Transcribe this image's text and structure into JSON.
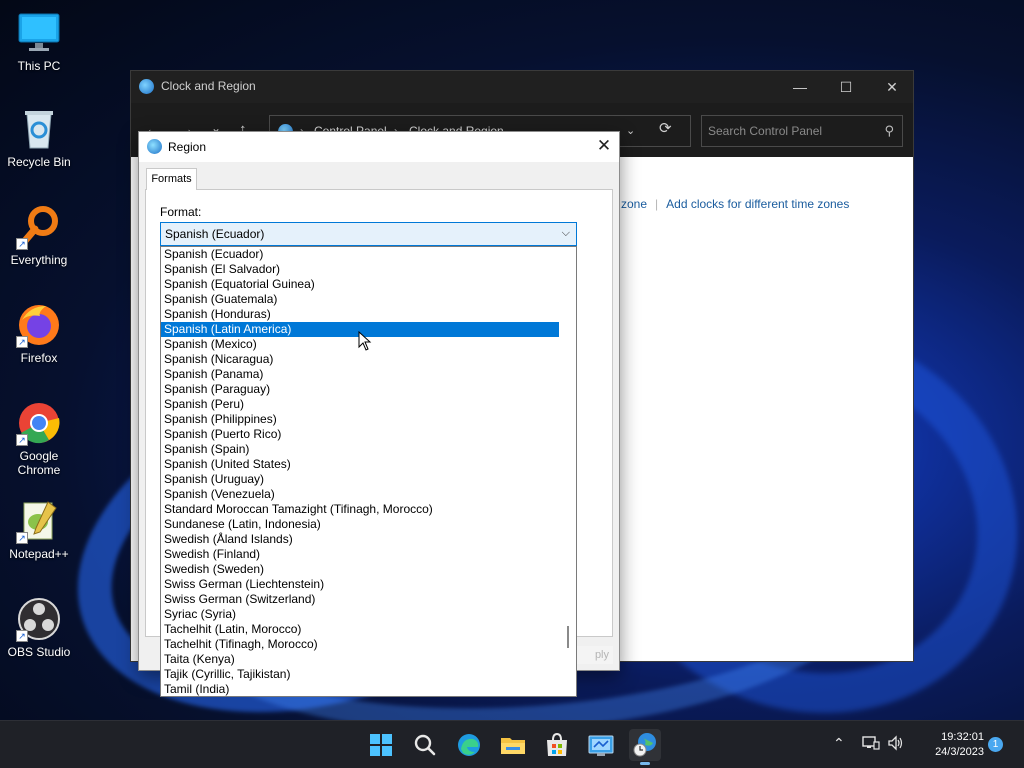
{
  "desktop": {
    "icons": [
      {
        "label": "This PC"
      },
      {
        "label": "Recycle Bin"
      },
      {
        "label": "Everything"
      },
      {
        "label": "Firefox"
      },
      {
        "label": "Google Chrome"
      },
      {
        "label": "Notepad++"
      },
      {
        "label": "OBS Studio"
      }
    ]
  },
  "control_panel": {
    "title": "Clock and Region",
    "breadcrumb": [
      "Control Panel",
      "Clock and Region"
    ],
    "search_placeholder": "Search Control Panel",
    "links": [
      "zone",
      "Add clocks for different time zones"
    ]
  },
  "dialog": {
    "title": "Region",
    "tab": "Formats",
    "format_label": "Format:",
    "format_selected": "Spanish (Ecuador)",
    "apply_partial": "ply",
    "options": [
      "Spanish (Ecuador)",
      "Spanish (El Salvador)",
      "Spanish (Equatorial Guinea)",
      "Spanish (Guatemala)",
      "Spanish (Honduras)",
      "Spanish (Latin America)",
      "Spanish (Mexico)",
      "Spanish (Nicaragua)",
      "Spanish (Panama)",
      "Spanish (Paraguay)",
      "Spanish (Peru)",
      "Spanish (Philippines)",
      "Spanish (Puerto Rico)",
      "Spanish (Spain)",
      "Spanish (United States)",
      "Spanish (Uruguay)",
      "Spanish (Venezuela)",
      "Standard Moroccan Tamazight (Tifinagh, Morocco)",
      "Sundanese (Latin, Indonesia)",
      "Swedish (Åland Islands)",
      "Swedish (Finland)",
      "Swedish (Sweden)",
      "Swiss German (Liechtenstein)",
      "Swiss German (Switzerland)",
      "Syriac (Syria)",
      "Tachelhit (Latin, Morocco)",
      "Tachelhit (Tifinagh, Morocco)",
      "Taita (Kenya)",
      "Tajik (Cyrillic, Tajikistan)",
      "Tamil (India)"
    ],
    "highlighted_option": "Spanish (Latin America)"
  },
  "taskbar": {
    "apps": [
      "start-icon",
      "search-icon",
      "edge-icon",
      "file-explorer-icon",
      "store-icon",
      "control-panel-icon",
      "clock-region-icon"
    ],
    "time": "19:32:01",
    "date": "24/3/2023",
    "notification_count": "1"
  },
  "colors": {
    "accent": "#0078d7",
    "window_dark": "#202020",
    "taskbar": "#1f2127",
    "link": "#1a5c9e"
  }
}
